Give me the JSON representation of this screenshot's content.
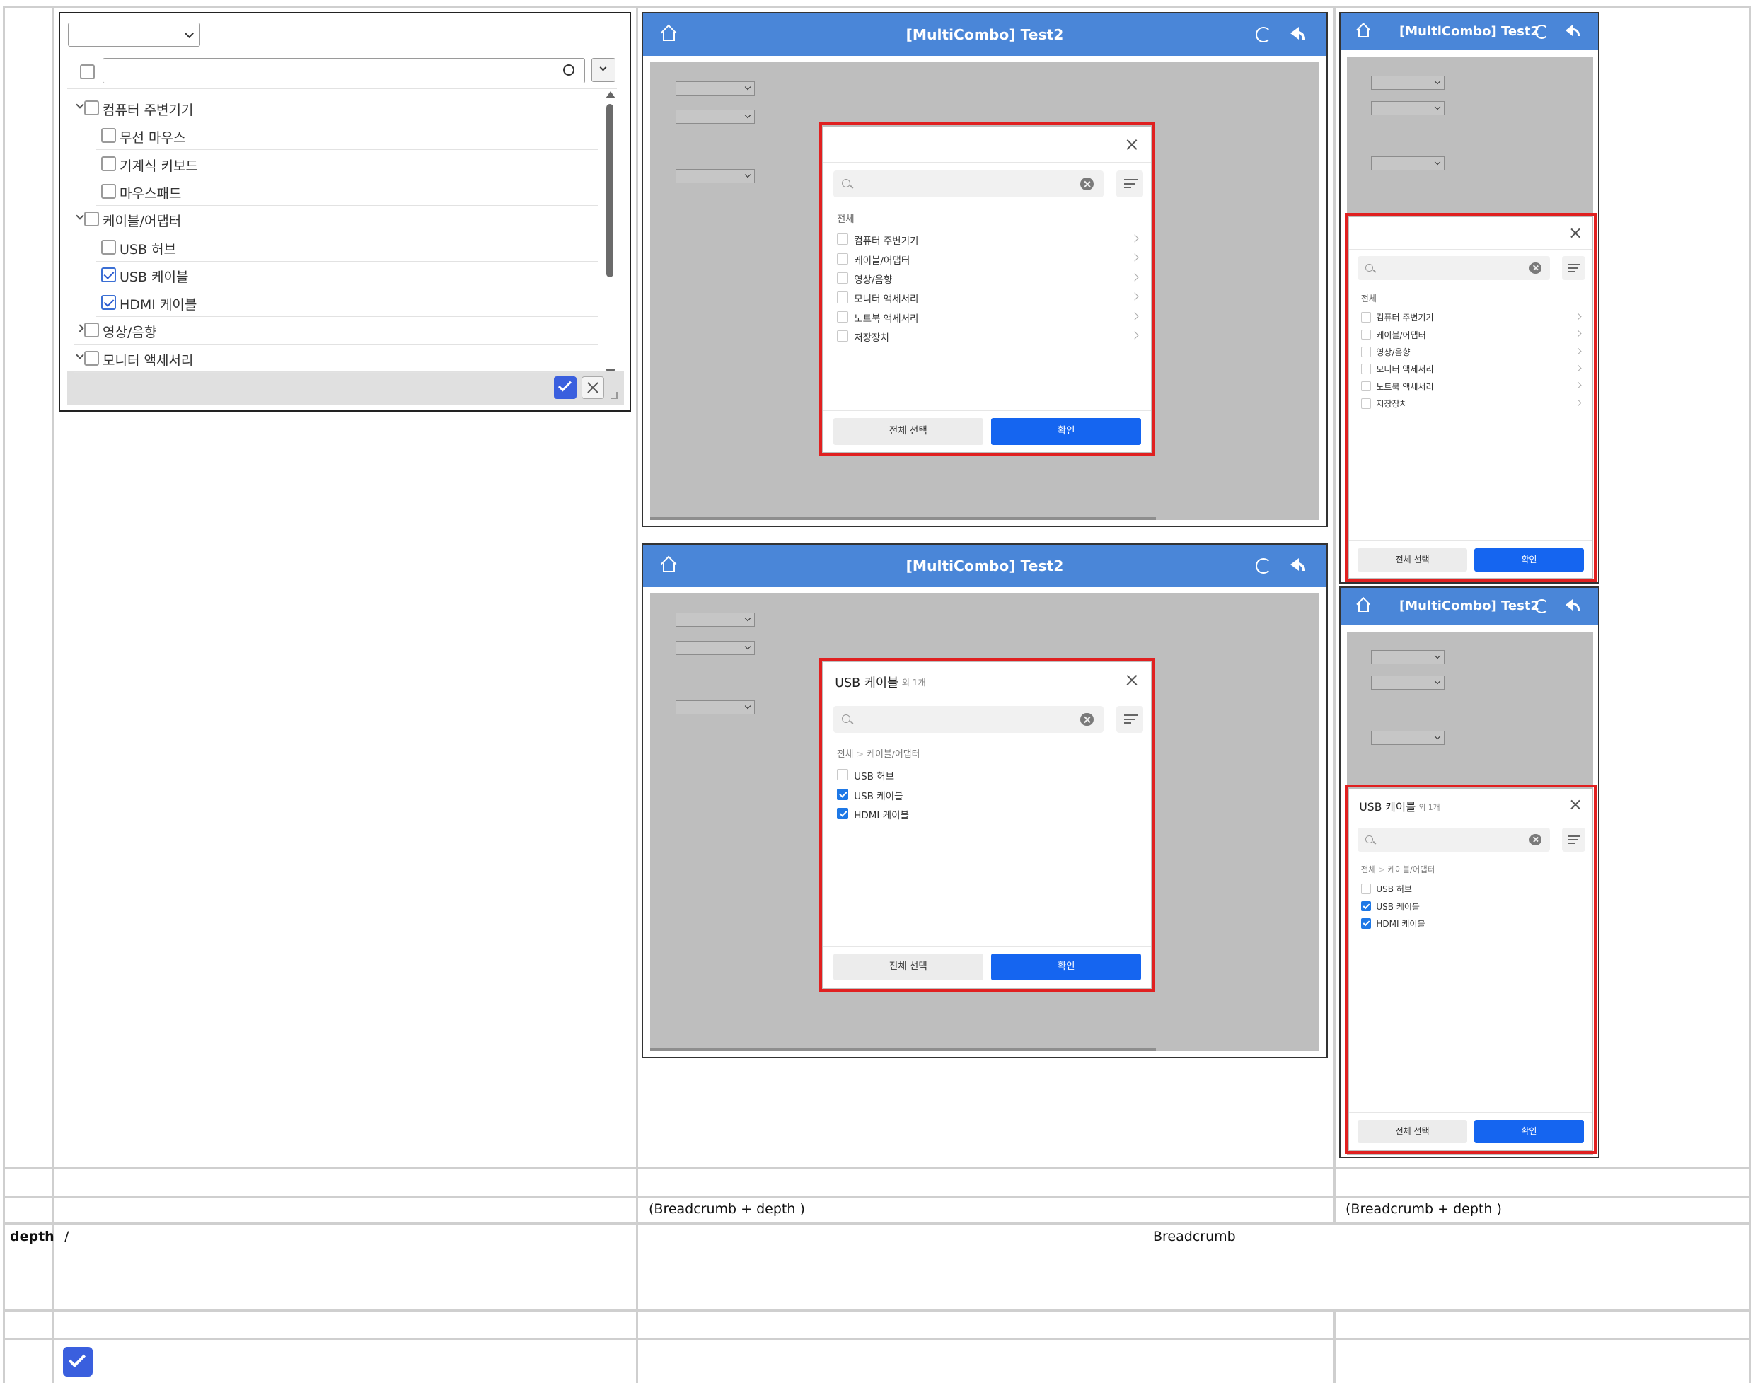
{
  "desktop": {
    "items": [
      {
        "label": "컴퓨터 주변기기",
        "level": 0,
        "checked": false,
        "expanded": true
      },
      {
        "label": "무선 마우스",
        "level": 1,
        "checked": false
      },
      {
        "label": "기계식 키보드",
        "level": 1,
        "checked": false
      },
      {
        "label": "마우스패드",
        "level": 1,
        "checked": false
      },
      {
        "label": "케이블/어댑터",
        "level": 0,
        "checked": false,
        "expanded": true
      },
      {
        "label": "USB 허브",
        "level": 1,
        "checked": false
      },
      {
        "label": "USB 케이블",
        "level": 1,
        "checked": true
      },
      {
        "label": "HDMI 케이블",
        "level": 1,
        "checked": true
      },
      {
        "label": "영상/음향",
        "level": 0,
        "checked": false,
        "expanded": false
      },
      {
        "label": "모니터 액세서리",
        "level": 0,
        "checked": false,
        "expanded": true
      }
    ]
  },
  "app": {
    "title": "[MultiCombo] Test2"
  },
  "popup": {
    "root_label": "전체",
    "categories": [
      "컴퓨터 주변기기",
      "케이블/어댑터",
      "영상/음향",
      "모니터 액세서리",
      "노트북 액세서리",
      "저장장치"
    ],
    "selected_title": "USB 케이블",
    "selected_suffix": "외 1개",
    "breadcrumb_root": "전체",
    "breadcrumb_sep": ">",
    "breadcrumb_current": "케이블/어댑터",
    "subitems": [
      {
        "label": "USB 허브",
        "checked": false
      },
      {
        "label": "USB 케이블",
        "checked": true
      },
      {
        "label": "HDMI 케이블",
        "checked": true
      }
    ],
    "select_all": "전체 선택",
    "confirm": "확인"
  },
  "table": {
    "note1": "(Breadcrumb + depth )",
    "note2": "(Breadcrumb + depth )",
    "row_label": "depth",
    "row_slash": "/",
    "row_breadcrumb": "Breadcrumb"
  },
  "colors": {
    "accent": "#4a86d8",
    "confirm": "#1565f0",
    "highlight": "#e02020",
    "checkbox": "#3b5bdb"
  },
  "icons": [
    "home-icon",
    "refresh-icon",
    "back-icon",
    "search-icon",
    "close-icon",
    "clear-icon",
    "sort-icon",
    "chevron-right-icon",
    "check-icon",
    "resize-grip-icon"
  ]
}
